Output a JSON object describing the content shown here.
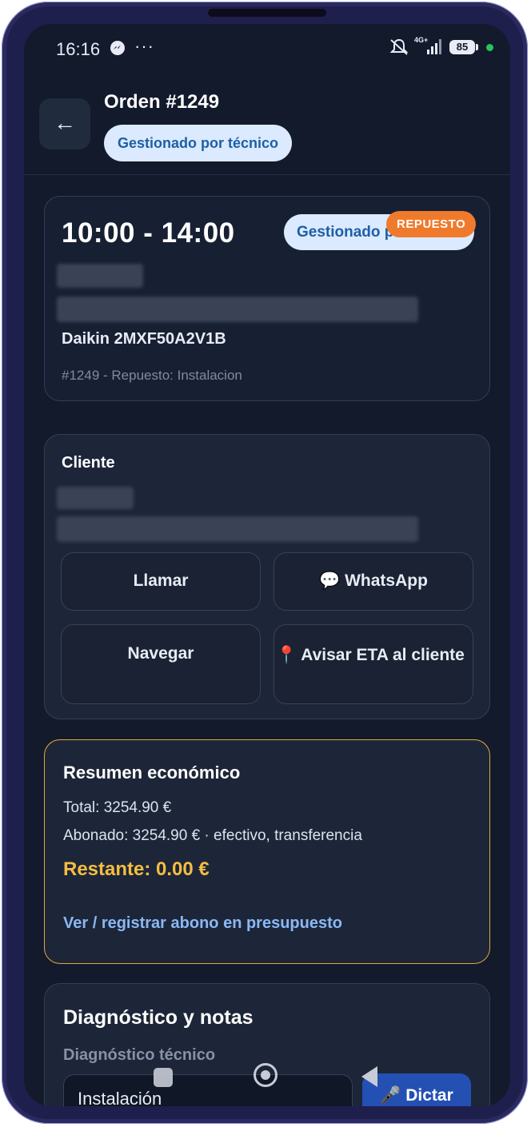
{
  "status_bar": {
    "time": "16:16",
    "more_indicator": "···",
    "network": "4G+",
    "battery": "85"
  },
  "header": {
    "back_label": "←",
    "title": "Orden #1249",
    "badge": "Gestionado por técnico"
  },
  "appointment": {
    "time_range": "10:00 - 14:00",
    "status_pill": "Gestionado por técnico",
    "tag": "REPUESTO",
    "model": "Daikin 2MXF50A2V1B",
    "meta": "#1249 - Repuesto: Instalacion"
  },
  "client": {
    "label": "Cliente",
    "call_button": "Llamar",
    "whatsapp_button": "💬 WhatsApp",
    "navigate_button": "Navegar",
    "eta_button": "📍 Avisar ETA al cliente"
  },
  "summary": {
    "title": "Resumen económico",
    "total": "Total: 3254.90 €",
    "paid": "Abonado: 3254.90 € · efectivo, transferencia",
    "remaining": "Restante: 0.00 €",
    "link": "Ver / registrar abono en presupuesto"
  },
  "diagnosis": {
    "title": "Diagnóstico y notas",
    "subtitle": "Diagnóstico técnico",
    "field_value": "Instalación",
    "dictate_button": "🎤 Dictar"
  },
  "icons": [
    "messenger-icon",
    "bell-muted-icon",
    "signal-icon",
    "battery-icon",
    "back-arrow-icon",
    "nav-recent-icon",
    "nav-home-icon",
    "nav-back-icon"
  ],
  "colors": {
    "background": "#131a2c",
    "card": "#1d2638",
    "accent_orange": "#f07a2c",
    "summary_border": "#e0a93a",
    "remaining": "#f5bd41",
    "link": "#8ab8f5",
    "dictate": "#2450b4"
  }
}
